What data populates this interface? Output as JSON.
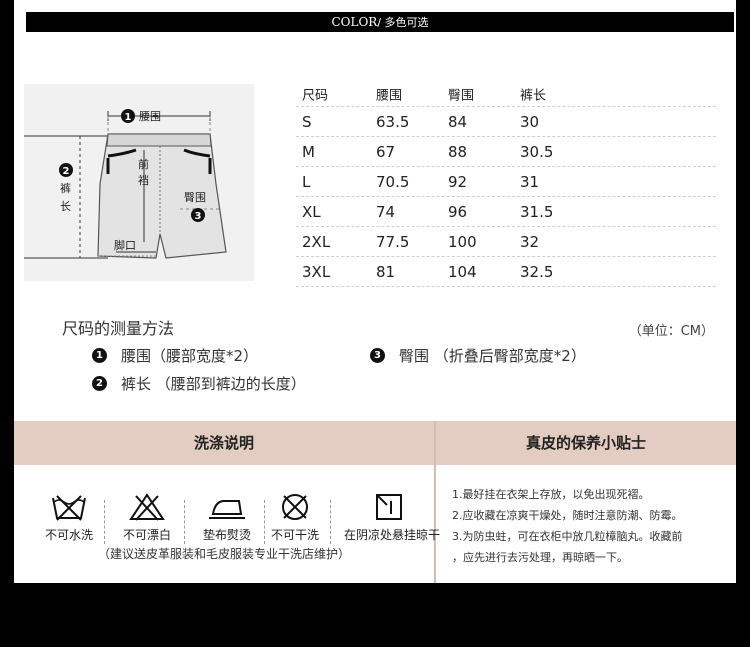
{
  "header": {
    "color_label": "COLOR",
    "color_suffix": "/ 多色可选"
  },
  "diagram": {
    "waist_label": "腰围",
    "length_label_1": "裤",
    "length_label_2": "长",
    "crotch_label_1": "前",
    "crotch_label_2": "裆",
    "hip_label": "臀围",
    "hem_label": "脚口",
    "badges": [
      "1",
      "2",
      "3"
    ]
  },
  "size_table": {
    "headers": [
      "尺码",
      "腰围",
      "臀围",
      "裤长"
    ],
    "rows": [
      [
        "S",
        "63.5",
        "84",
        "30"
      ],
      [
        "M",
        "67",
        "88",
        "30.5"
      ],
      [
        "L",
        "70.5",
        "92",
        "31"
      ],
      [
        "XL",
        "74",
        "96",
        "31.5"
      ],
      [
        "2XL",
        "77.5",
        "100",
        "32"
      ],
      [
        "3XL",
        "81",
        "104",
        "32.5"
      ]
    ]
  },
  "measure": {
    "title": "尺码的测量方法",
    "unit": "（单位：CM）",
    "items": [
      {
        "num": "1",
        "text": "腰围（腰部宽度*2）"
      },
      {
        "num": "2",
        "text": "裤长 （腰部到裤边的长度）"
      },
      {
        "num": "3",
        "text": "臀围 （折叠后臀部宽度*2）"
      }
    ]
  },
  "care": {
    "wash_title": "洗涤说明",
    "tips_title": "真皮的保养小贴士",
    "icons": [
      {
        "icon": "no-water-wash-icon",
        "label": "不可水洗"
      },
      {
        "icon": "no-bleach-icon",
        "label": "不可漂白"
      },
      {
        "icon": "iron-with-cloth-icon",
        "label": "垫布熨烫"
      },
      {
        "icon": "no-dry-clean-icon",
        "label": "不可干洗"
      },
      {
        "icon": "hang-dry-shade-icon",
        "label": "在阴凉处悬挂晾干"
      }
    ],
    "note": "（建议送皮革服装和毛皮服装专业干洗店维护）",
    "tips": [
      "1.最好挂在衣架上存放，以免出现死褶。",
      "2.应收藏在凉爽干燥处，随时注意防潮、防霉。",
      "3.为防虫蛀，可在衣柜中放几粒樟脑丸。收藏前",
      "，应先进行去污处理，再晾晒一下。"
    ]
  }
}
